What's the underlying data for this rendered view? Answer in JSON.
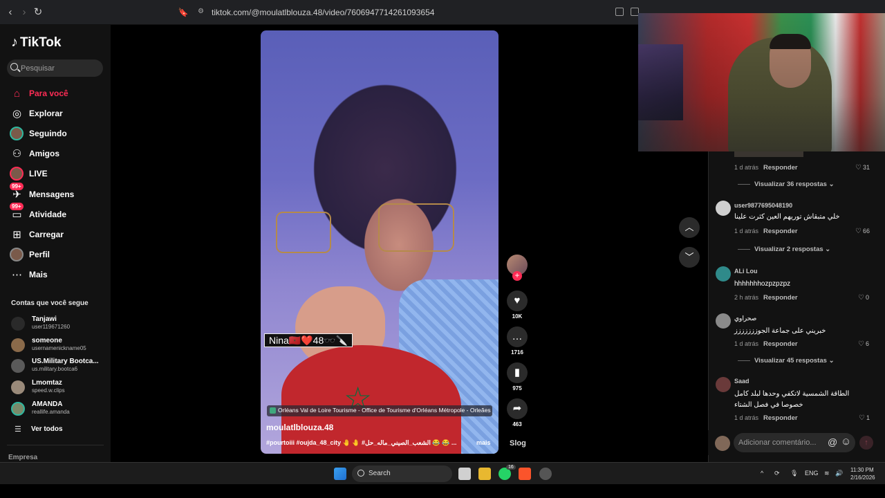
{
  "browser": {
    "url": "tiktok.com/@moulatlblouza.48/video/7606947714261093654"
  },
  "sidebar": {
    "logo": "TikTok",
    "search_placeholder": "Pesquisar",
    "nav": [
      {
        "label": "Para você",
        "icon": "home-icon",
        "active": true
      },
      {
        "label": "Explorar",
        "icon": "compass-icon"
      },
      {
        "label": "Seguindo",
        "icon": "following-avatar-icon"
      },
      {
        "label": "Amigos",
        "icon": "friends-icon"
      },
      {
        "label": "LIVE",
        "icon": "live-icon"
      },
      {
        "label": "Mensagens",
        "icon": "messages-icon",
        "badge": "99+"
      },
      {
        "label": "Atividade",
        "icon": "activity-icon",
        "badge": "99+"
      },
      {
        "label": "Carregar",
        "icon": "upload-icon"
      },
      {
        "label": "Perfil",
        "icon": "profile-icon"
      },
      {
        "label": "Mais",
        "icon": "more-icon"
      }
    ],
    "following_title": "Contas que você segue",
    "accounts": [
      {
        "name": "Tanjawi",
        "username": "user119671260"
      },
      {
        "name": "someone",
        "username": "usernamenickname05"
      },
      {
        "name": "US.Military Bootca...",
        "username": "us.military.bootca6"
      },
      {
        "name": "Lmomtaz",
        "username": "speed.w.clips"
      },
      {
        "name": "AMANDA",
        "username": "reallife.amanda"
      }
    ],
    "see_all": "Ver todos",
    "footer": "Empresa"
  },
  "video": {
    "sticker": "Nina🇲🇦❤️48🕶️🔪",
    "location": "Orléans Val de Loire Tourisme - Office de Tourisme d'Orléans Métropole - Orleães",
    "username": "moulatlblouza.48",
    "caption": "#pourtoiii #oujda_48_city 🤚 🤚 #الشعب_الصيني_ماله_حل 😂 😂 ...",
    "more": "mais",
    "likes": "10K",
    "comments": "1716",
    "saves": "975",
    "shares": "463",
    "slog_label": "Slog"
  },
  "comments": {
    "items": [
      {
        "id": "c1",
        "time": "1 d atrás",
        "reply": "Responder",
        "likes": "31",
        "view_replies": "Visualizar 36 respostas"
      },
      {
        "id": "c2",
        "user": "user9877695048190",
        "text": "خلي متبقاش توريهم العين كثرت علينا",
        "time": "1 d atrás",
        "reply": "Responder",
        "likes": "66",
        "view_replies": "Visualizar 2 respostas"
      },
      {
        "id": "c3",
        "user": "ALi Lou",
        "text": "hhhhhhhozpzpzpz",
        "time": "2 h atrás",
        "reply": "Responder",
        "likes": "0"
      },
      {
        "id": "c4",
        "user": "صحراوي",
        "text": "خبريني على جماعة الجوززززززز",
        "time": "1 d atrás",
        "reply": "Responder",
        "likes": "6",
        "view_replies": "Visualizar 45 respostas"
      },
      {
        "id": "c5",
        "user": "Saad",
        "text_line1": "الطاقة الشمسية لاتكفي وحدها لبلد كامل",
        "text_line2": "خصوصا في فصل الشتاء",
        "time": "1 d atrás",
        "reply": "Responder",
        "likes": "1"
      }
    ],
    "add_placeholder": "Adicionar comentário..."
  },
  "taskbar": {
    "search_label": "Search",
    "whatsapp_badge": "16",
    "lang": "ENG",
    "time": "11:30 PM",
    "date": "2/16/2026"
  },
  "colors": {
    "accent": "#fe2c55",
    "sidebar_bg": "#121212",
    "page_bg": "#000000"
  }
}
